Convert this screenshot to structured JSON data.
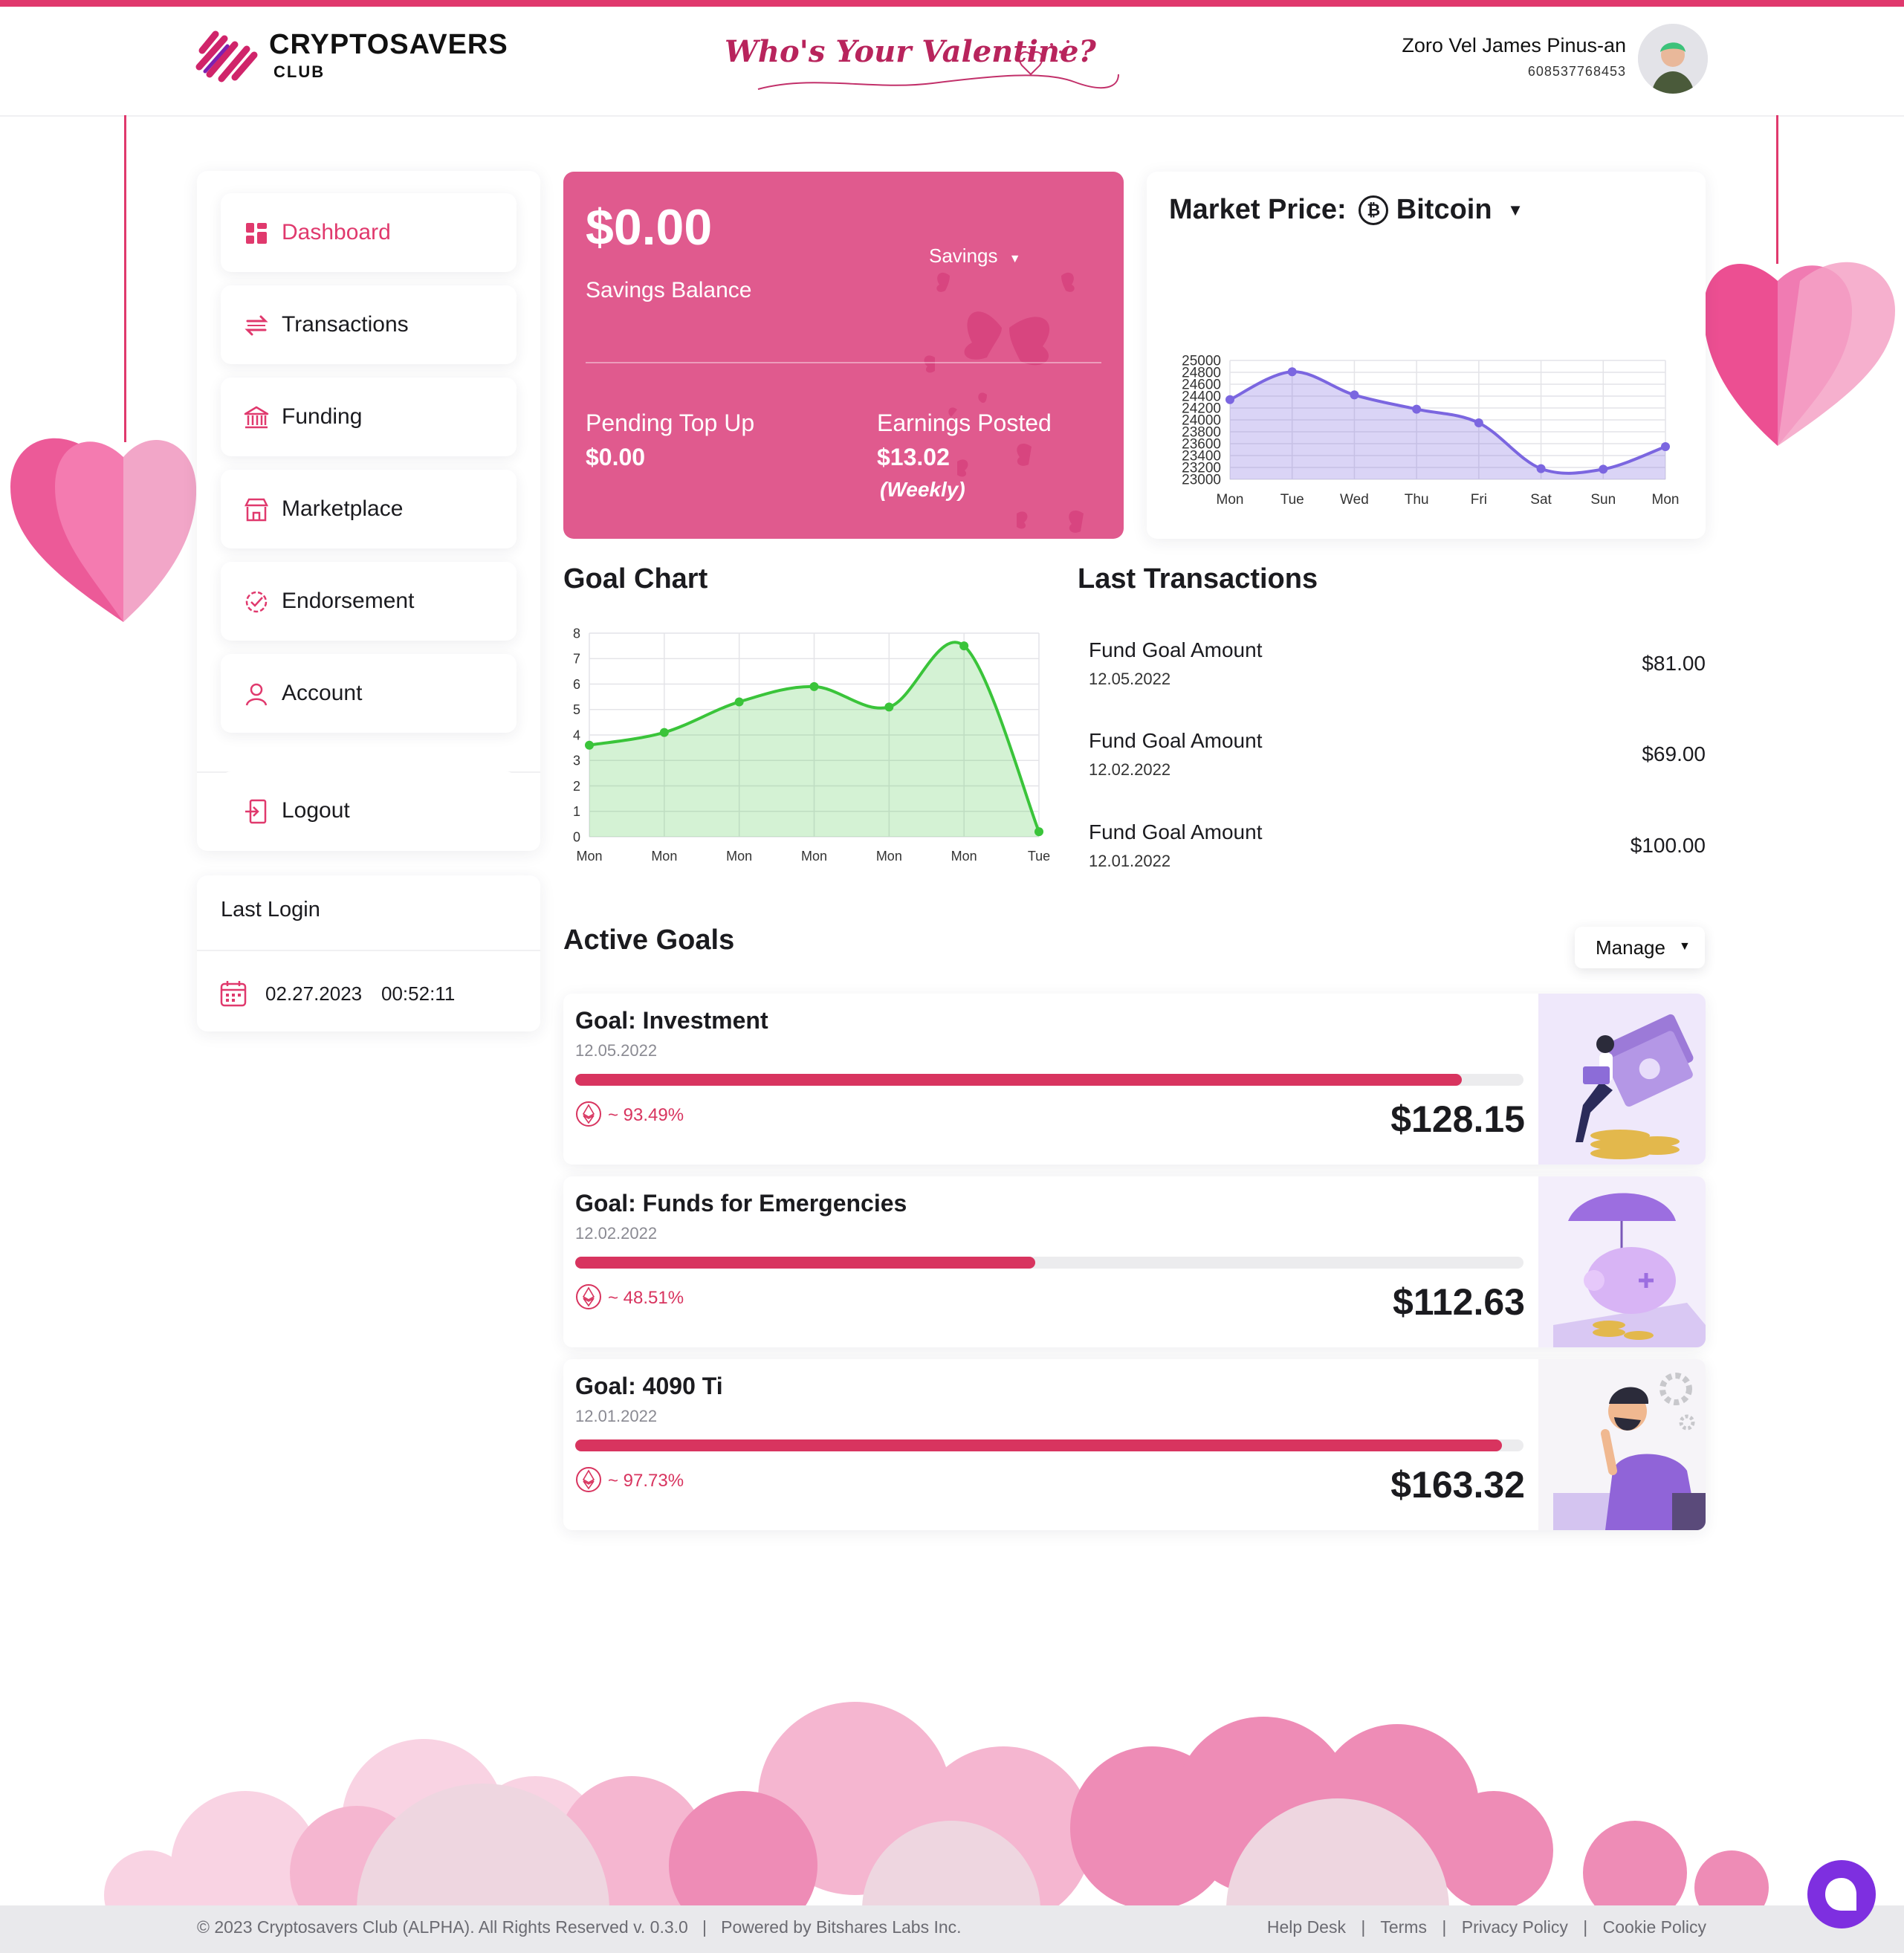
{
  "brand": {
    "name": "CRYPTOSAVERS",
    "sub": "CLUB"
  },
  "banner": {
    "text": "Who's Your Valentine?"
  },
  "user": {
    "name": "Zoro Vel James Pinus-an",
    "id": "608537768453"
  },
  "sidebar": {
    "items": [
      {
        "label": "Dashboard",
        "icon": "dashboard-icon",
        "active": true
      },
      {
        "label": "Transactions",
        "icon": "transactions-icon"
      },
      {
        "label": "Funding",
        "icon": "bank-icon"
      },
      {
        "label": "Marketplace",
        "icon": "store-icon"
      },
      {
        "label": "Endorsement",
        "icon": "badge-icon"
      },
      {
        "label": "Account",
        "icon": "user-icon"
      }
    ],
    "logout": "Logout"
  },
  "last_login": {
    "title": "Last Login",
    "date": "02.27.2023",
    "time": "00:52:11"
  },
  "savings": {
    "balance": "$0.00",
    "balance_label": "Savings Balance",
    "dropdown": "Savings",
    "pending_label": "Pending Top Up",
    "pending_value": "$0.00",
    "earnings_label": "Earnings Posted",
    "earnings_value": "$13.02",
    "earnings_period": "(Weekly)"
  },
  "market": {
    "title_prefix": "Market Price:",
    "coin": "Bitcoin"
  },
  "goal_chart": {
    "title": "Goal Chart"
  },
  "transactions": {
    "title": "Last Transactions",
    "items": [
      {
        "title": "Fund Goal Amount",
        "date": "12.05.2022",
        "amount": "$81.00"
      },
      {
        "title": "Fund Goal Amount",
        "date": "12.02.2022",
        "amount": "$69.00"
      },
      {
        "title": "Fund Goal Amount",
        "date": "12.01.2022",
        "amount": "$100.00"
      }
    ]
  },
  "active_goals": {
    "title": "Active Goals",
    "manage_label": "Manage",
    "goals": [
      {
        "name": "Goal: Investment",
        "date": "12.05.2022",
        "percent_text": "~ 93.49%",
        "progress": 93.49,
        "amount": "$128.15"
      },
      {
        "name": "Goal: Funds for Emergencies",
        "date": "12.02.2022",
        "percent_text": "~ 48.51%",
        "progress": 48.51,
        "amount": "$112.63"
      },
      {
        "name": "Goal: 4090 Ti",
        "date": "12.01.2022",
        "percent_text": "~ 97.73%",
        "progress": 97.73,
        "amount": "$163.32"
      }
    ]
  },
  "footer": {
    "left": "© 2023 Cryptosavers Club (ALPHA). All Rights Reserved v. 0.3.0   |   Powered by Bitshares Labs Inc.",
    "links": [
      "Help Desk",
      "Terms",
      "Privacy Policy",
      "Cookie Policy"
    ]
  },
  "colors": {
    "accent": "#e0396d",
    "card_pink": "#e05a8e",
    "market_line": "#7b66e0",
    "goal_line": "#3ac43a",
    "chat": "#7e2fe0"
  },
  "chart_data": [
    {
      "type": "area",
      "x": [
        "Mon",
        "Tue",
        "Wed",
        "Thu",
        "Fri",
        "Sat",
        "Sun",
        "Mon"
      ],
      "series": [
        {
          "values": [
            24340,
            24810,
            24420,
            24180,
            23950,
            23180,
            23170,
            23550
          ]
        }
      ],
      "ylim": [
        23000,
        25000
      ],
      "yticks": [
        25000,
        24800,
        24600,
        24400,
        24200,
        24000,
        23800,
        23600,
        23400,
        23200,
        23000
      ],
      "grid": true
    },
    {
      "type": "area",
      "x": [
        "Mon",
        "Mon",
        "Mon",
        "Mon",
        "Mon",
        "Mon",
        "Tue"
      ],
      "series": [
        {
          "values": [
            3.6,
            4.1,
            5.3,
            5.9,
            5.1,
            7.5,
            0.2
          ]
        }
      ],
      "ylim": [
        0,
        8
      ],
      "yticks": [
        8,
        7,
        6,
        5,
        4,
        3,
        2,
        1,
        0
      ],
      "grid": true
    }
  ]
}
